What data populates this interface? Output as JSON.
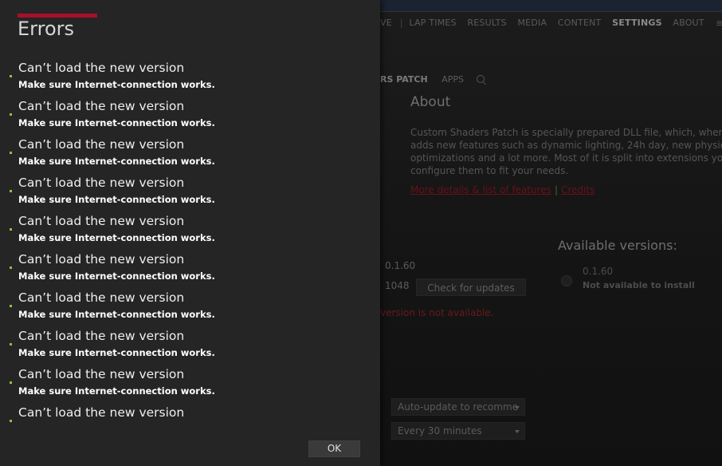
{
  "background_app": {
    "nav": [
      "VE",
      "LAP TIMES",
      "RESULTS",
      "MEDIA",
      "CONTENT",
      "SETTINGS",
      "ABOUT"
    ],
    "nav_active": "SETTINGS",
    "subnav": {
      "current": "RS PATCH",
      "apps": "APPS"
    },
    "about": {
      "title": "About",
      "lines": [
        "Custom Shaders Patch is specially prepared DLL file, which, when pla",
        "adds new features such as dynamic lighting, 24h day, new physics fe",
        "optimizations and a lot more. Most of it is split into extensions you ca",
        "configure them to fit your needs."
      ],
      "link_details": "More details & list of features",
      "link_separator": "|",
      "link_credits": "Credits"
    },
    "installed_version": "0.1.60",
    "installed_build": "1048",
    "check_updates_label": "Check for updates",
    "error_text": "version is not available.",
    "available": {
      "title": "Available versions:",
      "version": "0.1.60",
      "status": "Not available to install"
    },
    "auto_update_value": "Auto-update to recomme",
    "interval_value": "Every 30 minutes"
  },
  "dialog": {
    "title": "Errors",
    "errors": [
      {
        "title": "Can’t load the new version",
        "description": "Make sure Internet-connection works."
      },
      {
        "title": "Can’t load the new version",
        "description": "Make sure Internet-connection works."
      },
      {
        "title": "Can’t load the new version",
        "description": "Make sure Internet-connection works."
      },
      {
        "title": "Can’t load the new version",
        "description": "Make sure Internet-connection works."
      },
      {
        "title": "Can’t load the new version",
        "description": "Make sure Internet-connection works."
      },
      {
        "title": "Can’t load the new version",
        "description": "Make sure Internet-connection works."
      },
      {
        "title": "Can’t load the new version",
        "description": "Make sure Internet-connection works."
      },
      {
        "title": "Can’t load the new version",
        "description": "Make sure Internet-connection works."
      },
      {
        "title": "Can’t load the new version",
        "description": "Make sure Internet-connection works."
      },
      {
        "title": "Can’t load the new version",
        "description": ""
      }
    ],
    "ok_label": "OK"
  },
  "colors": {
    "accent": "#a6102a",
    "bullet": "#8bc34a",
    "dialog_bg": "#252525"
  }
}
